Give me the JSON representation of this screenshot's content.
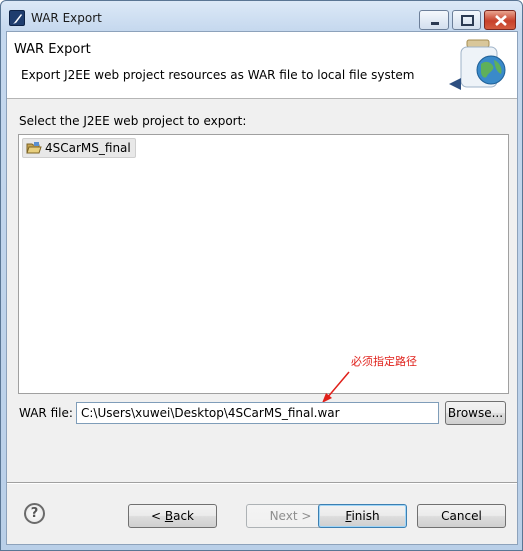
{
  "window": {
    "title": "WAR Export"
  },
  "header": {
    "title": "WAR Export",
    "description": "Export J2EE web project resources as WAR file to local file system",
    "art_icon": "war-export-globe-icon"
  },
  "project_section": {
    "label": "Select the J2EE web project to export:",
    "projects": [
      {
        "name": "4SCarMS_final",
        "icon": "open-folder-icon"
      }
    ]
  },
  "annotation": {
    "text": "必须指定路径",
    "color": "#e0201a"
  },
  "war_file": {
    "label": "WAR file:",
    "value": "C:\\Users\\xuwei\\Desktop\\4SCarMS_final.war",
    "browse_label": "Browse..."
  },
  "buttons": {
    "back_prefix": "< ",
    "back_mnemonic": "B",
    "back_rest": "ack",
    "next_label": "Next >",
    "finish_mnemonic": "F",
    "finish_rest": "inish",
    "cancel_label": "Cancel",
    "help_glyph": "?"
  }
}
